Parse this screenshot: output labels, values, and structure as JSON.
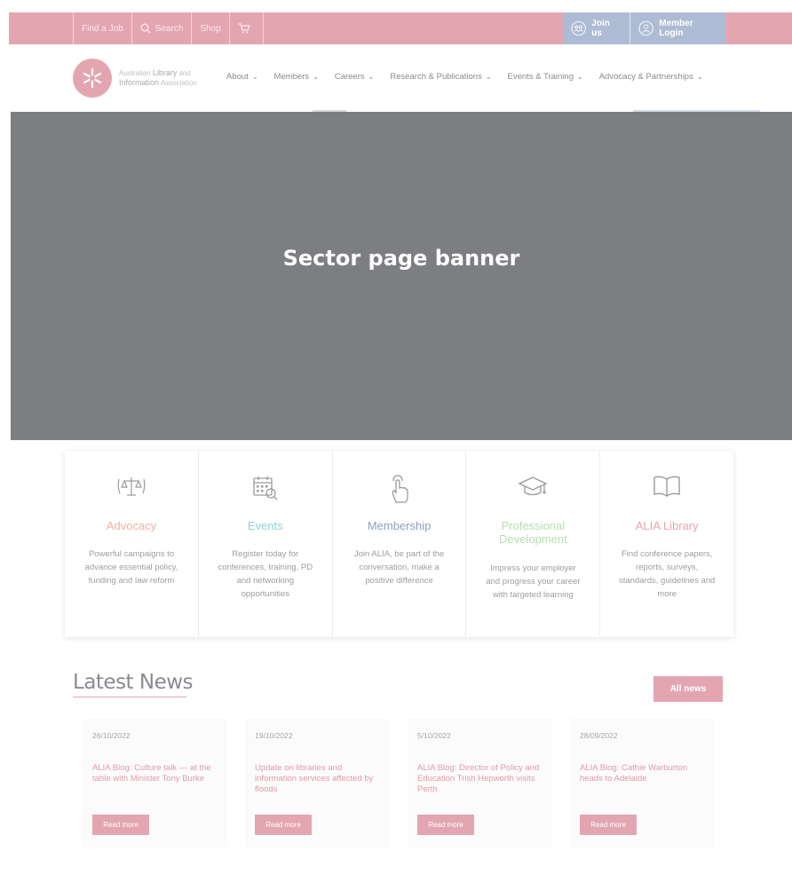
{
  "colors": {
    "brand_pink": "#e3a6b1",
    "account_blue": "#aebbd4",
    "banner_gray": "#7d7e82",
    "events_teal": "#8fd3d0",
    "membership_blue": "#8f9ec0",
    "pd_green": "#b8dcb4"
  },
  "topbar": {
    "links": [
      {
        "label": "Find a Job",
        "icon": ""
      },
      {
        "label": "Search",
        "icon": "search-icon"
      },
      {
        "label": "Shop",
        "icon": ""
      }
    ],
    "cart_icon": "cart-icon",
    "join_label": "Join us",
    "login_label": "Member Login"
  },
  "logo": {
    "line1_small": "Australian",
    "line1_bold": "Library",
    "line1_tail": "and",
    "line2_bold": "Information",
    "line2_tail": "Association"
  },
  "nav": {
    "items": [
      {
        "label": "About"
      },
      {
        "label": "Members"
      },
      {
        "label": "Careers"
      },
      {
        "label": "Research & Publications"
      },
      {
        "label": "Events & Training"
      },
      {
        "label": "Advocacy & Partnerships"
      }
    ],
    "chevron": "⌄"
  },
  "banner": {
    "text": "Sector page banner"
  },
  "cards": [
    {
      "icon": "scales-icon",
      "title": "Advocacy",
      "color": "#efb3a6",
      "desc": "Powerful campaigns to advance essential policy, funding and law reform"
    },
    {
      "icon": "calendar-search-icon",
      "title": "Events",
      "color": "#8fd3d0",
      "desc": "Register today for conferences, training, PD and networking opportunities"
    },
    {
      "icon": "pointer-hand-icon",
      "title": "Membership",
      "color": "#8f9ec0",
      "desc": "Join ALIA, be part of the conversation, make a positive difference"
    },
    {
      "icon": "graduation-cap-icon",
      "title": "Professional Development",
      "color": "#b8dcb4",
      "desc": "Impress your employer and progress your career with targeted learning"
    },
    {
      "icon": "open-book-icon",
      "title": "ALIA Library",
      "color": "#e3a6b1",
      "desc": "Find conference papers, reports, surveys, standards, guidelines and more"
    }
  ],
  "news": {
    "title": "Latest News",
    "all_label": "All news",
    "items": [
      {
        "date": "26/10/2022",
        "title": "ALIA Blog: Culture talk — at the table with Minister Tony Burke",
        "read_more": "Read more"
      },
      {
        "date": "19/10/2022",
        "title": "Update on libraries and information services affected by floods",
        "read_more": "Read more"
      },
      {
        "date": "5/10/2022",
        "title": "ALIA Blog: Director of Policy and Education Trish Hepworth visits Perth",
        "read_more": "Read more"
      },
      {
        "date": "28/09/2022",
        "title": "ALIA Blog: Cathie Warburton heads to Adelaide",
        "read_more": "Read more"
      }
    ]
  }
}
